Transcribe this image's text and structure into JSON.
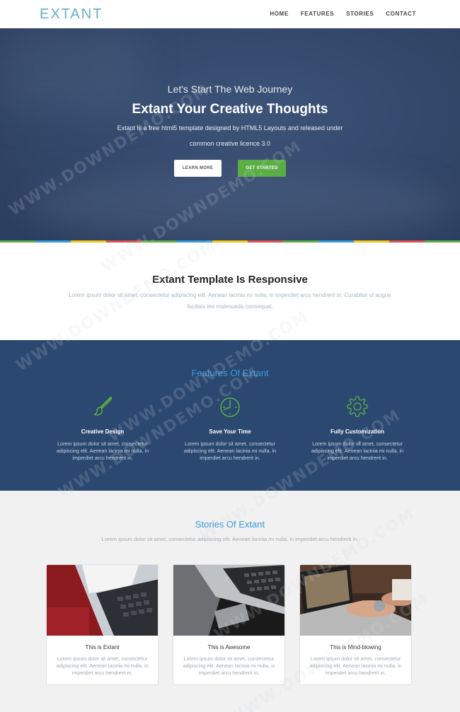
{
  "navbar": {
    "logo": "EXTANT",
    "links": [
      "HOME",
      "FEATURES",
      "STORIES",
      "CONTACT"
    ]
  },
  "hero": {
    "subtitle": "Let's Start The Web Journey",
    "title": "Extant Your Creative Thoughts",
    "description": "Extant is a free html5 template designed by HTML5 Layouts and released under common creative licence 3.0",
    "learn_more": "LEARN MORE",
    "get_started": "GET STARTED"
  },
  "stripe_colors": [
    "#5bae45",
    "#3a9ad9",
    "#f0c419",
    "#d9534f",
    "#5bae45",
    "#3a9ad9",
    "#f0c419",
    "#d9534f",
    "#5bae45",
    "#3a9ad9",
    "#f0c419",
    "#d9534f",
    "#5bae45"
  ],
  "responsive": {
    "title": "Extant Template Is Responsive",
    "text": "Lorem ipsum dolor sit amet, consectetur adipiscing elit. Aenean lacinia mi nulla, in imperdiet arcu hendrerit in. Curabitur ut augue facilisis leo malesuada consequat."
  },
  "features": {
    "title": "Features Of Extant",
    "items": [
      {
        "icon": "brush-icon",
        "name": "Creative Design",
        "text": "Lorem ipsum dolor sit amet, consectetur adipiscing elit. Aenean lacinia mi nulla, in imperdiet arcu hendrerit in."
      },
      {
        "icon": "clock-icon",
        "name": "Save Your Time",
        "text": "Lorem ipsum dolor sit amet, consectetur adipiscing elit. Aenean lacinia mi nulla, in imperdiet arcu hendrerit in."
      },
      {
        "icon": "gear-icon",
        "name": "Fully Customization",
        "text": "Lorem ipsum dolor sit amet, consectetur adipiscing elit. Aenean lacinia mi nulla, in imperdiet arcu hendrerit in."
      }
    ]
  },
  "stories": {
    "title": "Stories Of Extant",
    "text": "Lorem ipsum dolor sit amet, consectetur adipiscing elit. Aenean lacinia mi nulla, in imperdiet arcu hendrerit in.",
    "cards": [
      {
        "title": "This is Extant",
        "text": "Lorem ipsum dolor sit amet, consectetur adipiscing elit. Aenean lacinia mi nulla, in imperdiet arcu hendrerit in."
      },
      {
        "title": "This is Awesome",
        "text": "Lorem ipsum dolor sit amet, consectetur adipiscing elit. Aenean lacinia mi nulla, in imperdiet arcu hendrerit in."
      },
      {
        "title": "This is Mind-blowing",
        "text": "Lorem ipsum dolor sit amet, consectetur adipiscing elit. Aenean lacinia mi nulla, in imperdiet arcu hendrerit in."
      }
    ]
  },
  "watermark": "WWW.DOWNDEMO.COM"
}
